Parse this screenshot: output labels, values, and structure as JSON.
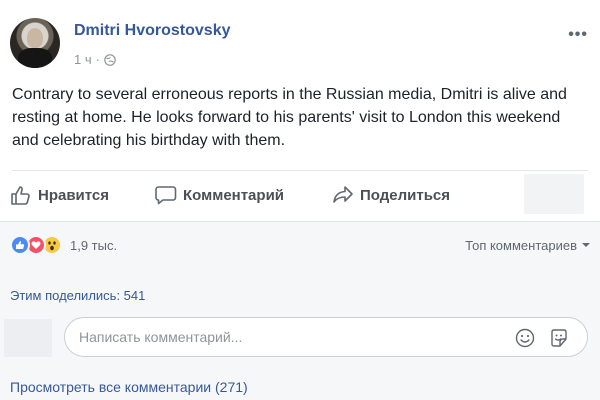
{
  "post": {
    "author": "Dmitri Hvorostovsky",
    "time": "1 ч",
    "separator": "·",
    "text": "Contrary to several erroneous reports in the Russian media, Dmitri is alive and resting at home. He looks forward to his parents' visit to London this weekend and celebrating his birthday with them."
  },
  "actions": {
    "like": "Нравится",
    "comment": "Комментарий",
    "share": "Поделиться"
  },
  "reactions": {
    "icons": [
      "like-reaction",
      "love-reaction",
      "wow-reaction"
    ],
    "count": "1,9 тыс.",
    "sort_label": "Топ комментариев"
  },
  "shares": "Этим поделились: 541",
  "composer": {
    "placeholder": "Написать комментарий..."
  },
  "view_all_comments": "Просмотреть все комментарии (271)",
  "colors": {
    "link": "#365899",
    "like": "#4c8bf5",
    "love": "#f25268",
    "wow": "#f7c945"
  }
}
